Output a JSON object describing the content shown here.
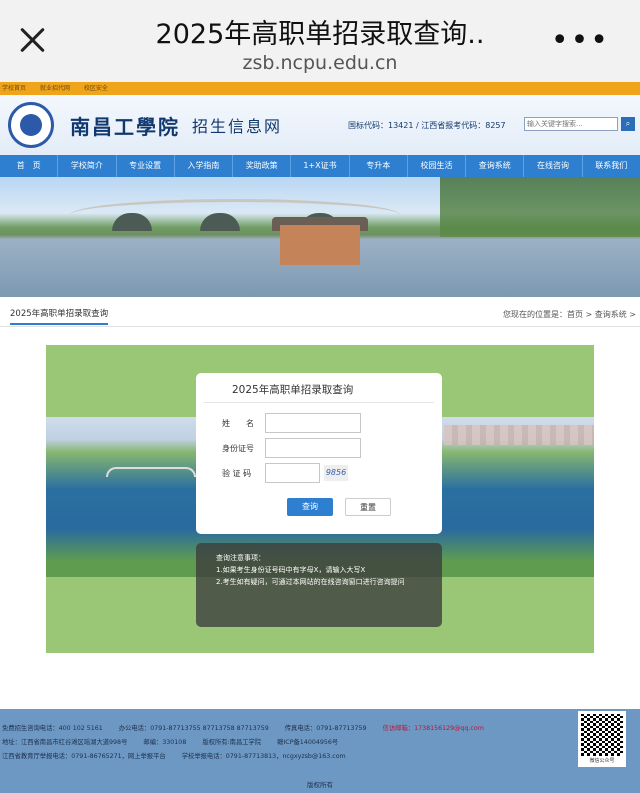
{
  "chrome": {
    "title": "2025年高职单招录取查询..",
    "url": "zsb.ncpu.edu.cn"
  },
  "topstrip": [
    "学校首页",
    "就业招代网",
    "校区安全"
  ],
  "header": {
    "school_name": "南昌工學院",
    "site_name": "招生信息网",
    "codes": "国标代码：13421 / 江西省报考代码：8257",
    "search_placeholder": "输入关键字搜索..."
  },
  "nav": [
    "首　页",
    "学校简介",
    "专业设置",
    "入学指南",
    "奖助政策",
    "1+X证书",
    "专升本",
    "校园生活",
    "查询系统",
    "在线咨询",
    "联系我们"
  ],
  "breadcrumb": {
    "title": "2025年高职单招录取查询",
    "path": "您现在的位置是：首页 > 查询系统 >"
  },
  "form": {
    "title": "2025年高职单招录取查询",
    "name_label": "姓　　名",
    "id_label": "身份证号",
    "captcha_label": "验 证 码",
    "captcha_text": "9856",
    "query_button": "查询",
    "reset_button": "重置"
  },
  "notes": {
    "heading": "查询注意事项：",
    "line1": "1.如果考生身份证号码中有字母X，请输入大写X",
    "line2": "2.考生如有疑问，可通过本网站的在线咨询窗口进行咨询提问"
  },
  "footer": {
    "row1": [
      "免费招生咨询电话：400 102 5161",
      "办公电话：0791-87713755 87713758 87713759",
      "传真电话：0791-87713759"
    ],
    "row1_red": "信访邮箱：1738156129@qq.com",
    "row2": [
      "地址：江西省南昌市红谷滩区瑶湖大道998号",
      "邮编：330108",
      "版权所有:南昌工学院",
      "赣ICP备14004956号"
    ],
    "row3": [
      "江西省教育厅举报电话：0791-86765271，网上举报平台",
      "学校举报电话：0791-87713813，ncgxyzsb@163.com"
    ],
    "qr_caption": "微信公众号",
    "copyright": "版权所有"
  }
}
